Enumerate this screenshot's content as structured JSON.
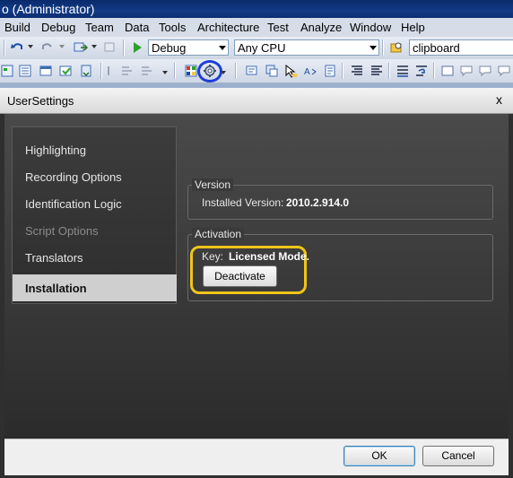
{
  "window": {
    "title": "o (Administrator)"
  },
  "menu": [
    "Build",
    "Debug",
    "Team",
    "Data",
    "Tools",
    "Architecture",
    "Test",
    "Analyze",
    "Window",
    "Help"
  ],
  "toolbar": {
    "configuration": "Debug",
    "platform": "Any CPU",
    "find_text": "clipboard"
  },
  "dialog": {
    "title": "UserSettings",
    "close": "x",
    "nav": {
      "items": [
        {
          "label": "Highlighting",
          "enabled": true
        },
        {
          "label": "Recording Options",
          "enabled": true
        },
        {
          "label": "Identification Logic",
          "enabled": true
        },
        {
          "label": "Script Options",
          "enabled": false
        },
        {
          "label": "Translators",
          "enabled": true
        },
        {
          "label": "Installation",
          "enabled": true,
          "selected": true
        }
      ]
    },
    "version_group": {
      "title": "Version",
      "installed_label": "Installed Version:",
      "installed_value": "2010.2.914.0"
    },
    "activation_group": {
      "title": "Activation",
      "key_label": "Key:",
      "key_value": "Licensed Mode.",
      "deactivate_label": "Deactivate"
    },
    "ok_label": "OK",
    "cancel_label": "Cancel"
  },
  "colors": {
    "highlight_toolbar_circle": "#1d3fd6",
    "highlight_activation": "#f0c419"
  }
}
